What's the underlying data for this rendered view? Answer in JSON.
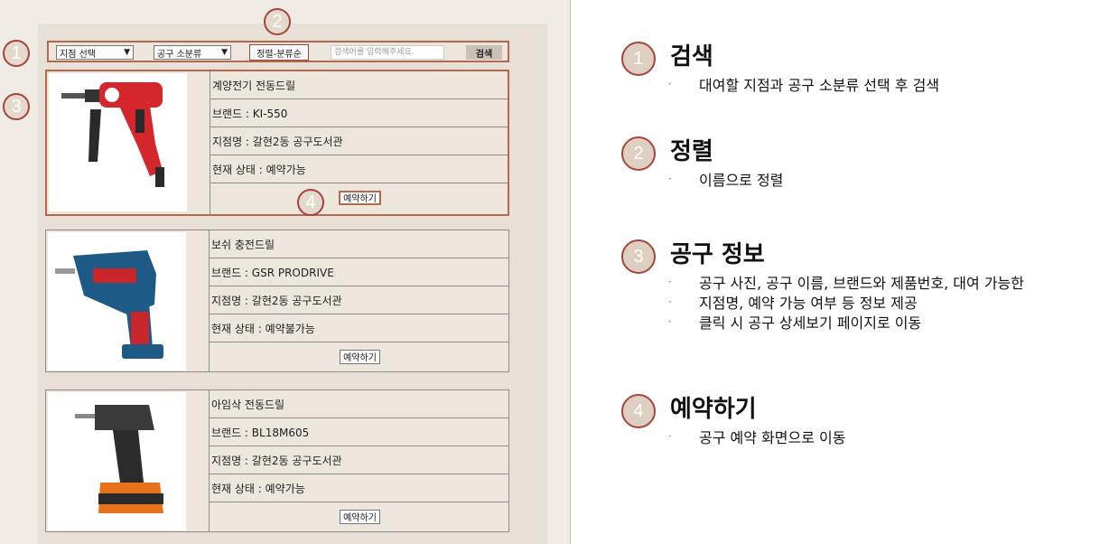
{
  "markers": [
    "1",
    "2",
    "3",
    "4"
  ],
  "search_bar": {
    "branch_select": "지점 선택",
    "category_select": "공구 소분류",
    "sort_button": "정렬-분류순",
    "search_placeholder": "검색어를 입력해주세요.",
    "search_button": "검색"
  },
  "tools": [
    {
      "name": "계양전기 전동드릴",
      "brand": "브랜드 : KI-550",
      "branch": "지점명 : 갈현2동 공구도서관",
      "status": "현재 상태 : 예약가능",
      "reserve_label": "예약하기",
      "photo_icon": "corded-drill-icon",
      "colors": {
        "body": "#d3262d",
        "handle": "#2a2a2a"
      }
    },
    {
      "name": "보쉬 충전드릴",
      "brand": "브랜드 : GSR PRODRIVE",
      "branch": "지점명 : 갈현2동 공구도서관",
      "status": "현재 상태 : 예약불가능",
      "reserve_label": "예약하기",
      "photo_icon": "cordless-screwdriver-icon",
      "colors": {
        "body": "#1e5a86",
        "grip": "#c8262b"
      }
    },
    {
      "name": "아임삭 전동드릴",
      "brand": "브랜드 : BL18M605",
      "branch": "지점명 : 갈현2동 공구도서관",
      "status": "현재 상태 : 예약가능",
      "reserve_label": "예약하기",
      "photo_icon": "impact-driver-icon",
      "colors": {
        "body": "#3a3a3a",
        "battery": "#e8721c"
      }
    }
  ],
  "sections": [
    {
      "num": "1",
      "title": "검색",
      "bullets": [
        "대여할 지점과 공구 소분류 선택 후 검색"
      ]
    },
    {
      "num": "2",
      "title": "정렬",
      "bullets": [
        "이름으로 정렬"
      ]
    },
    {
      "num": "3",
      "title": "공구 정보",
      "bullets": [
        "공구 사진, 공구 이름, 브랜드와 제품번호, 대여 가능한",
        "지점명, 예약 가능 여부 등 정보 제공",
        "클릭 시 공구 상세보기 페이지로 이동"
      ]
    },
    {
      "num": "4",
      "title": "예약하기",
      "bullets": [
        "공구 예약 화면으로 이동"
      ]
    }
  ],
  "accent_color": "#a9433b"
}
